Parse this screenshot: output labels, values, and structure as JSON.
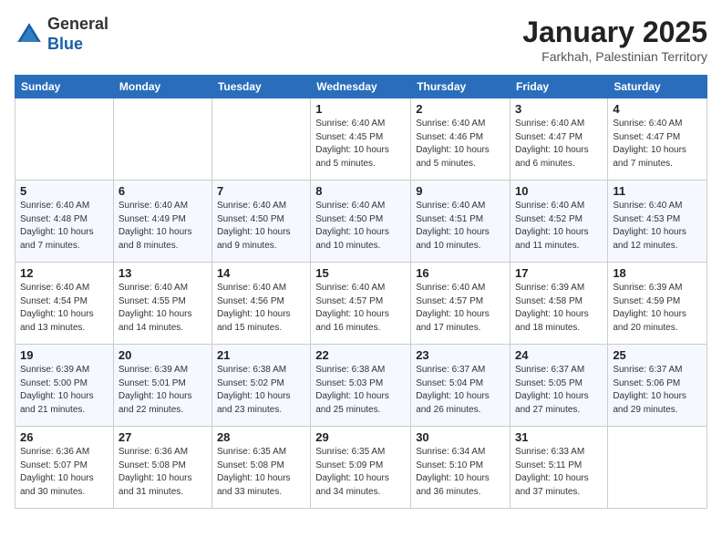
{
  "header": {
    "logo_line1": "General",
    "logo_line2": "Blue",
    "month": "January 2025",
    "location": "Farkhah, Palestinian Territory"
  },
  "days_of_week": [
    "Sunday",
    "Monday",
    "Tuesday",
    "Wednesday",
    "Thursday",
    "Friday",
    "Saturday"
  ],
  "weeks": [
    [
      {
        "day": "",
        "info": ""
      },
      {
        "day": "",
        "info": ""
      },
      {
        "day": "",
        "info": ""
      },
      {
        "day": "1",
        "info": "Sunrise: 6:40 AM\nSunset: 4:45 PM\nDaylight: 10 hours\nand 5 minutes."
      },
      {
        "day": "2",
        "info": "Sunrise: 6:40 AM\nSunset: 4:46 PM\nDaylight: 10 hours\nand 5 minutes."
      },
      {
        "day": "3",
        "info": "Sunrise: 6:40 AM\nSunset: 4:47 PM\nDaylight: 10 hours\nand 6 minutes."
      },
      {
        "day": "4",
        "info": "Sunrise: 6:40 AM\nSunset: 4:47 PM\nDaylight: 10 hours\nand 7 minutes."
      }
    ],
    [
      {
        "day": "5",
        "info": "Sunrise: 6:40 AM\nSunset: 4:48 PM\nDaylight: 10 hours\nand 7 minutes."
      },
      {
        "day": "6",
        "info": "Sunrise: 6:40 AM\nSunset: 4:49 PM\nDaylight: 10 hours\nand 8 minutes."
      },
      {
        "day": "7",
        "info": "Sunrise: 6:40 AM\nSunset: 4:50 PM\nDaylight: 10 hours\nand 9 minutes."
      },
      {
        "day": "8",
        "info": "Sunrise: 6:40 AM\nSunset: 4:50 PM\nDaylight: 10 hours\nand 10 minutes."
      },
      {
        "day": "9",
        "info": "Sunrise: 6:40 AM\nSunset: 4:51 PM\nDaylight: 10 hours\nand 10 minutes."
      },
      {
        "day": "10",
        "info": "Sunrise: 6:40 AM\nSunset: 4:52 PM\nDaylight: 10 hours\nand 11 minutes."
      },
      {
        "day": "11",
        "info": "Sunrise: 6:40 AM\nSunset: 4:53 PM\nDaylight: 10 hours\nand 12 minutes."
      }
    ],
    [
      {
        "day": "12",
        "info": "Sunrise: 6:40 AM\nSunset: 4:54 PM\nDaylight: 10 hours\nand 13 minutes."
      },
      {
        "day": "13",
        "info": "Sunrise: 6:40 AM\nSunset: 4:55 PM\nDaylight: 10 hours\nand 14 minutes."
      },
      {
        "day": "14",
        "info": "Sunrise: 6:40 AM\nSunset: 4:56 PM\nDaylight: 10 hours\nand 15 minutes."
      },
      {
        "day": "15",
        "info": "Sunrise: 6:40 AM\nSunset: 4:57 PM\nDaylight: 10 hours\nand 16 minutes."
      },
      {
        "day": "16",
        "info": "Sunrise: 6:40 AM\nSunset: 4:57 PM\nDaylight: 10 hours\nand 17 minutes."
      },
      {
        "day": "17",
        "info": "Sunrise: 6:39 AM\nSunset: 4:58 PM\nDaylight: 10 hours\nand 18 minutes."
      },
      {
        "day": "18",
        "info": "Sunrise: 6:39 AM\nSunset: 4:59 PM\nDaylight: 10 hours\nand 20 minutes."
      }
    ],
    [
      {
        "day": "19",
        "info": "Sunrise: 6:39 AM\nSunset: 5:00 PM\nDaylight: 10 hours\nand 21 minutes."
      },
      {
        "day": "20",
        "info": "Sunrise: 6:39 AM\nSunset: 5:01 PM\nDaylight: 10 hours\nand 22 minutes."
      },
      {
        "day": "21",
        "info": "Sunrise: 6:38 AM\nSunset: 5:02 PM\nDaylight: 10 hours\nand 23 minutes."
      },
      {
        "day": "22",
        "info": "Sunrise: 6:38 AM\nSunset: 5:03 PM\nDaylight: 10 hours\nand 25 minutes."
      },
      {
        "day": "23",
        "info": "Sunrise: 6:37 AM\nSunset: 5:04 PM\nDaylight: 10 hours\nand 26 minutes."
      },
      {
        "day": "24",
        "info": "Sunrise: 6:37 AM\nSunset: 5:05 PM\nDaylight: 10 hours\nand 27 minutes."
      },
      {
        "day": "25",
        "info": "Sunrise: 6:37 AM\nSunset: 5:06 PM\nDaylight: 10 hours\nand 29 minutes."
      }
    ],
    [
      {
        "day": "26",
        "info": "Sunrise: 6:36 AM\nSunset: 5:07 PM\nDaylight: 10 hours\nand 30 minutes."
      },
      {
        "day": "27",
        "info": "Sunrise: 6:36 AM\nSunset: 5:08 PM\nDaylight: 10 hours\nand 31 minutes."
      },
      {
        "day": "28",
        "info": "Sunrise: 6:35 AM\nSunset: 5:08 PM\nDaylight: 10 hours\nand 33 minutes."
      },
      {
        "day": "29",
        "info": "Sunrise: 6:35 AM\nSunset: 5:09 PM\nDaylight: 10 hours\nand 34 minutes."
      },
      {
        "day": "30",
        "info": "Sunrise: 6:34 AM\nSunset: 5:10 PM\nDaylight: 10 hours\nand 36 minutes."
      },
      {
        "day": "31",
        "info": "Sunrise: 6:33 AM\nSunset: 5:11 PM\nDaylight: 10 hours\nand 37 minutes."
      },
      {
        "day": "",
        "info": ""
      }
    ]
  ]
}
